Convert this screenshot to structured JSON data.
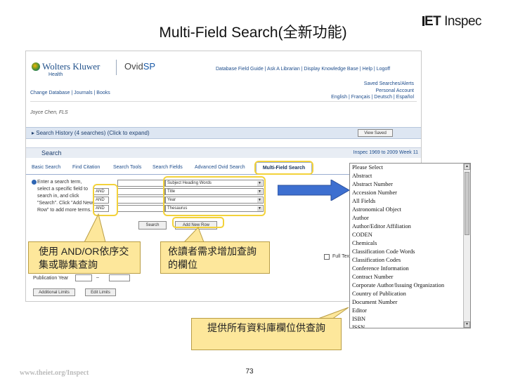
{
  "slide": {
    "title": "Multi-Field Search(全新功能)",
    "logo_text_left": "ET",
    "logo_text_right": "Inspec",
    "footer_url": "www.theiet.org/Inspect",
    "page_number": "73"
  },
  "ovid": {
    "brand": "Wolters Kluwer",
    "brand_sub": "Health",
    "product_prefix": "Ovid",
    "product_suffix": "SP",
    "top_nav": "Database Field Guide  |  Ask A Librarian  |  Display Knowledge Base  |  Help  |  Logoff",
    "saved_link": "Saved Searches/Alerts",
    "account_link": "Personal Account",
    "languages": "English  |  Français  |  Deutsch  |  Español",
    "change_links": "Change Database  |  Journals  |  Books",
    "user_name": "Joyce Chen, FLS",
    "history_label": "▸ Search History (4 searches) (Click to expand)",
    "view_saved": "View Saved",
    "search_label": "Search",
    "inspec_range": "Inspec 1969 to 2009 Week 11",
    "tabs": [
      "Basic Search",
      "Find Citation",
      "Search Tools",
      "Search Fields",
      "Advanced Ovid Search",
      "Multi-Field Search"
    ],
    "help_text": "Enter a search term, select a specific field to search in, and click \"Search\". Click \"Add New Row\" to add more terms.",
    "operators": [
      "AND",
      "AND",
      "AND"
    ],
    "row_fields": [
      "Subject Heading Words",
      "Title",
      "Year",
      "Thesaurus"
    ],
    "search_button": "Search",
    "add_row_button": "Add New Row",
    "full_text_label": "Full Text",
    "pubyear_label": "Publication Year",
    "additional_limits": "Additional Limits",
    "edit_limits": "Edit Limits"
  },
  "field_list": [
    "Please Select",
    "Abstract",
    "Abstract Number",
    "Accession Number",
    "All Fields",
    "Astronomical Object",
    "Author",
    "Author/Editor Affiliation",
    "CODEN",
    "Chemicals",
    "Classification Code Words",
    "Classification Codes",
    "Conference Information",
    "Contract Number",
    "Corporate Author/Issuing Organization",
    "Country of Publication",
    "Document Number",
    "Editor",
    "ISBN",
    "ISSN"
  ],
  "callouts": {
    "operators": "使用 AND/OR依序交集或聯集查詢",
    "add_row": "依讀者需求增加查詢的欄位",
    "fields": "提供所有資料庫欄位供查詢"
  },
  "colors": {
    "callout_fill": "#fde79b",
    "highlight": "#f3d23a",
    "arrow": "#3d6fd0",
    "link": "#1e4d8c"
  }
}
